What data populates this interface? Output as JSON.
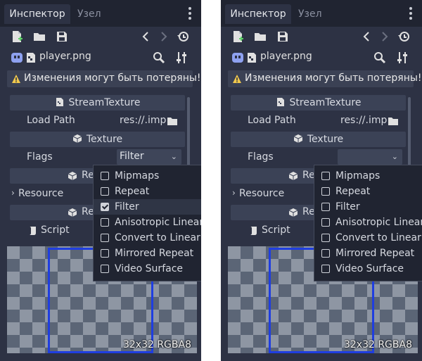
{
  "panels": [
    {
      "tabs": {
        "active": "Инспектор",
        "inactive": "Узел"
      },
      "file_name": "player.png",
      "warning_text": "Изменения могут быть потеряны!",
      "sections": {
        "stream_texture": "StreamTexture",
        "texture": "Texture"
      },
      "properties": {
        "load_path_label": "Load Path",
        "load_path_value": "res://.imp",
        "flags_label": "Flags",
        "flags_value": "Filter",
        "resource_label": "Resource",
        "script_label": "Script"
      },
      "clipped": {
        "re_1": "Re",
        "re_2": "Re"
      },
      "preview_info": "32x32 RGBA8",
      "flag_options": [
        {
          "label": "Mipmaps",
          "checked": false
        },
        {
          "label": "Repeat",
          "checked": false
        },
        {
          "label": "Filter",
          "checked": true
        },
        {
          "label": "Anisotropic Linear",
          "checked": false
        },
        {
          "label": "Convert to Linear",
          "checked": false
        },
        {
          "label": "Mirrored Repeat",
          "checked": false
        },
        {
          "label": "Video Surface",
          "checked": false
        }
      ]
    },
    {
      "tabs": {
        "active": "Инспектор",
        "inactive": "Узел"
      },
      "file_name": "player.png",
      "warning_text": "Изменения могут быть потеряны!",
      "sections": {
        "stream_texture": "StreamTexture",
        "texture": "Texture"
      },
      "properties": {
        "load_path_label": "Load Path",
        "load_path_value": "res://.imp",
        "flags_label": "Flags",
        "flags_value": "",
        "resource_label": "Resource",
        "script_label": "Script"
      },
      "clipped": {
        "re_1": "Re",
        "re_2": "Re"
      },
      "preview_info": "32x32 RGBA8",
      "flag_options": [
        {
          "label": "Mipmaps",
          "checked": false
        },
        {
          "label": "Repeat",
          "checked": false
        },
        {
          "label": "Filter",
          "checked": false
        },
        {
          "label": "Anisotropic Linear",
          "checked": false
        },
        {
          "label": "Convert to Linear",
          "checked": false
        },
        {
          "label": "Mirrored Repeat",
          "checked": false
        },
        {
          "label": "Video Surface",
          "checked": false
        }
      ]
    }
  ],
  "colors": {
    "panel_bg": "#2d3244",
    "tabbar_bg": "#202431",
    "section_bg": "#3b4256",
    "selection_blue": "#1f3ee0",
    "warning_yellow": "#f2c94c"
  },
  "icons": {
    "toolbar": [
      "new-resource-icon",
      "open-folder-icon",
      "save-icon",
      "back-arrow-icon",
      "forward-arrow-icon",
      "history-icon"
    ],
    "row2": [
      "image-icon",
      "stream-texture-icon",
      "search-icon",
      "settings-icon"
    ]
  }
}
